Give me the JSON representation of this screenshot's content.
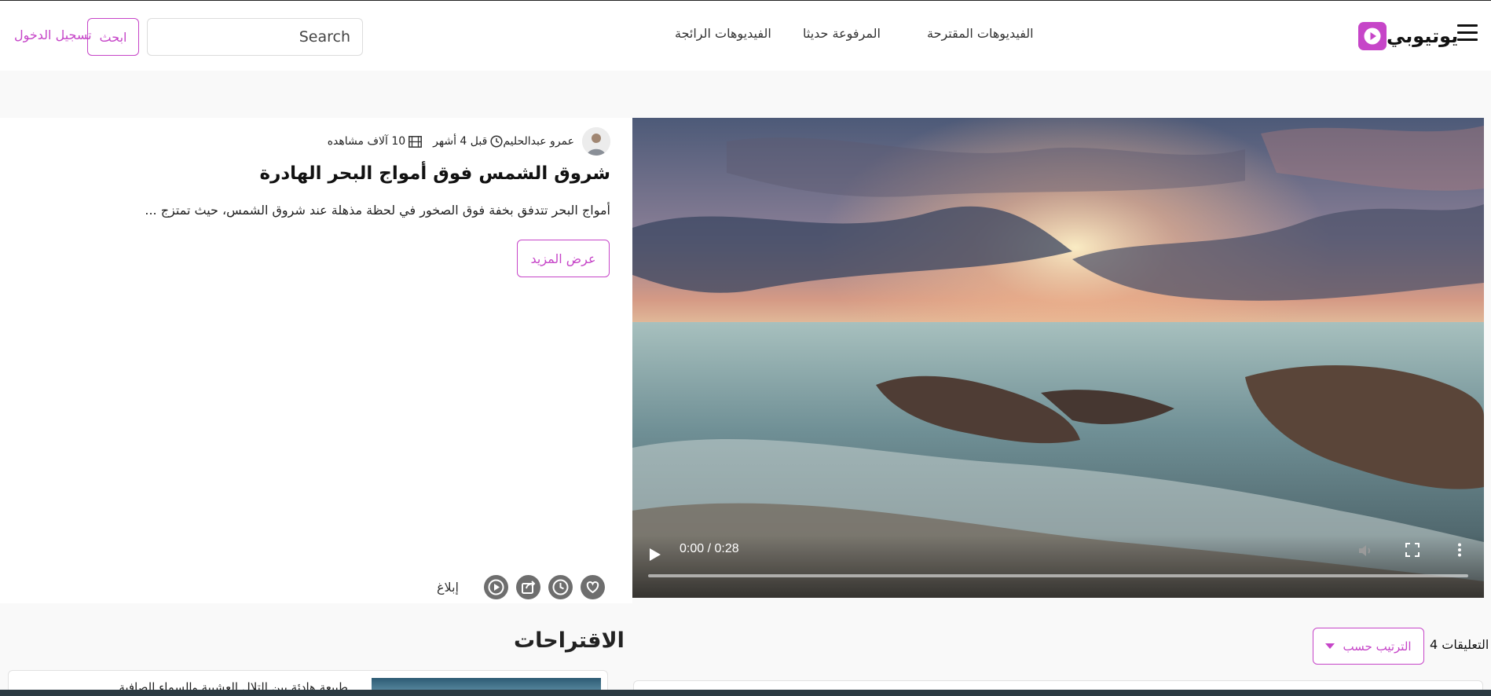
{
  "header": {
    "logo_text": "يوتيوبي",
    "nav": [
      {
        "label": "الفيديوهات المقترحة"
      },
      {
        "label": "المرفوعة حديثا"
      },
      {
        "label": "الفيديوهات الرائجة"
      }
    ],
    "search_placeholder": "Search",
    "search_button": "ابحث",
    "login_link": "تسجيل الدخول"
  },
  "video": {
    "author": "عمرو عبدالحليم",
    "published": "قبل 4 أشهر",
    "views": "10 آلاف مشاهده",
    "title": "شروق الشمس فوق أمواج البحر الهادرة",
    "description": "أمواج البحر تتدفق بخفة فوق الصخور في لحظة مذهلة عند شروق الشمس، حيث تمتزج ...",
    "more_button": "عرض المزيد",
    "report": "إبلاغ"
  },
  "player": {
    "time": "0:00 / 0:28",
    "progress": 0
  },
  "suggestions": {
    "title": "الاقتراحات",
    "items": [
      {
        "title": "طبيعة هادئة بين التلال العشبية والسماء الصافية"
      }
    ]
  },
  "comments": {
    "label": "التعليقات 4",
    "sort_button": "الترتيب حسب"
  },
  "colors": {
    "accent": "#c645c8",
    "icon_gray": "#6e6e6e"
  }
}
